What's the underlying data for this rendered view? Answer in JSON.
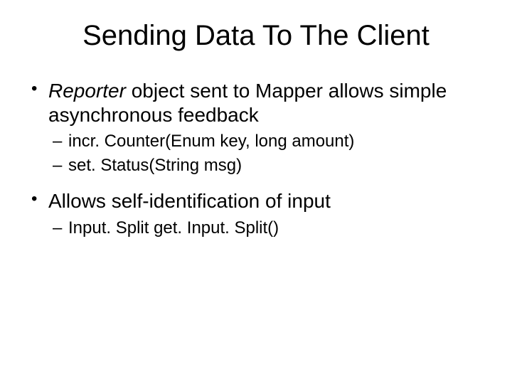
{
  "title": "Sending Data To The Client",
  "bullets": [
    {
      "prefix_italic": "Reporter",
      "rest": " object sent to Mapper allows simple asynchronous feedback",
      "sub": [
        "incr. Counter(Enum key, long amount)",
        "set. Status(String msg)"
      ]
    },
    {
      "prefix_italic": "",
      "rest": "Allows self-identification of input",
      "sub": [
        "Input. Split get. Input. Split()"
      ]
    }
  ]
}
